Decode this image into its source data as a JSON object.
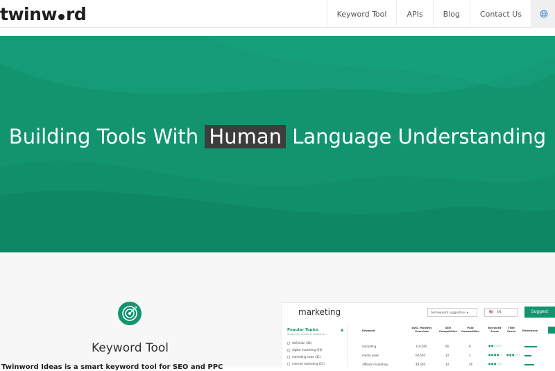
{
  "nav": {
    "logo": "twinw",
    "logo_suffix": "rd",
    "links": [
      "Keyword Tool",
      "APIs",
      "Blog",
      "Contact Us"
    ]
  },
  "hero": {
    "title_before": "Building Tools With ",
    "title_highlight": "Human",
    "title_after": " Language Understanding"
  },
  "feature": {
    "title": "Keyword Tool",
    "description": "Twinword Ideas is a smart keyword tool for SEO and PPC"
  },
  "app": {
    "query": "marketing",
    "suggestion_select": "Get keyword suggestions",
    "language": "EN",
    "suggest_button": "Suggest",
    "popular_topics_title": "Popular Topics",
    "popular_topics_sub": "Show only keywords related to...",
    "topics": [
      "definition (44)",
      "digital marketing (36)",
      "marketing news (31)",
      "internet marketing (25)"
    ],
    "columns": [
      "Keyword",
      "AVG. Monthly Searches",
      "SEO Competition",
      "Paid Competition",
      "Keyword Score",
      "Title Score",
      "Relevance"
    ],
    "rows": [
      {
        "keyword": "marketing",
        "searches": "110,000",
        "seo": "66",
        "paid": "8"
      },
      {
        "keyword": "media news",
        "searches": "60,500",
        "seo": "10",
        "paid": "3"
      },
      {
        "keyword": "affiliate marketing",
        "searches": "49,500",
        "seo": "10",
        "paid": "46"
      }
    ]
  },
  "colors": {
    "brand": "#12956f",
    "highlight": "#3d3d3d"
  }
}
